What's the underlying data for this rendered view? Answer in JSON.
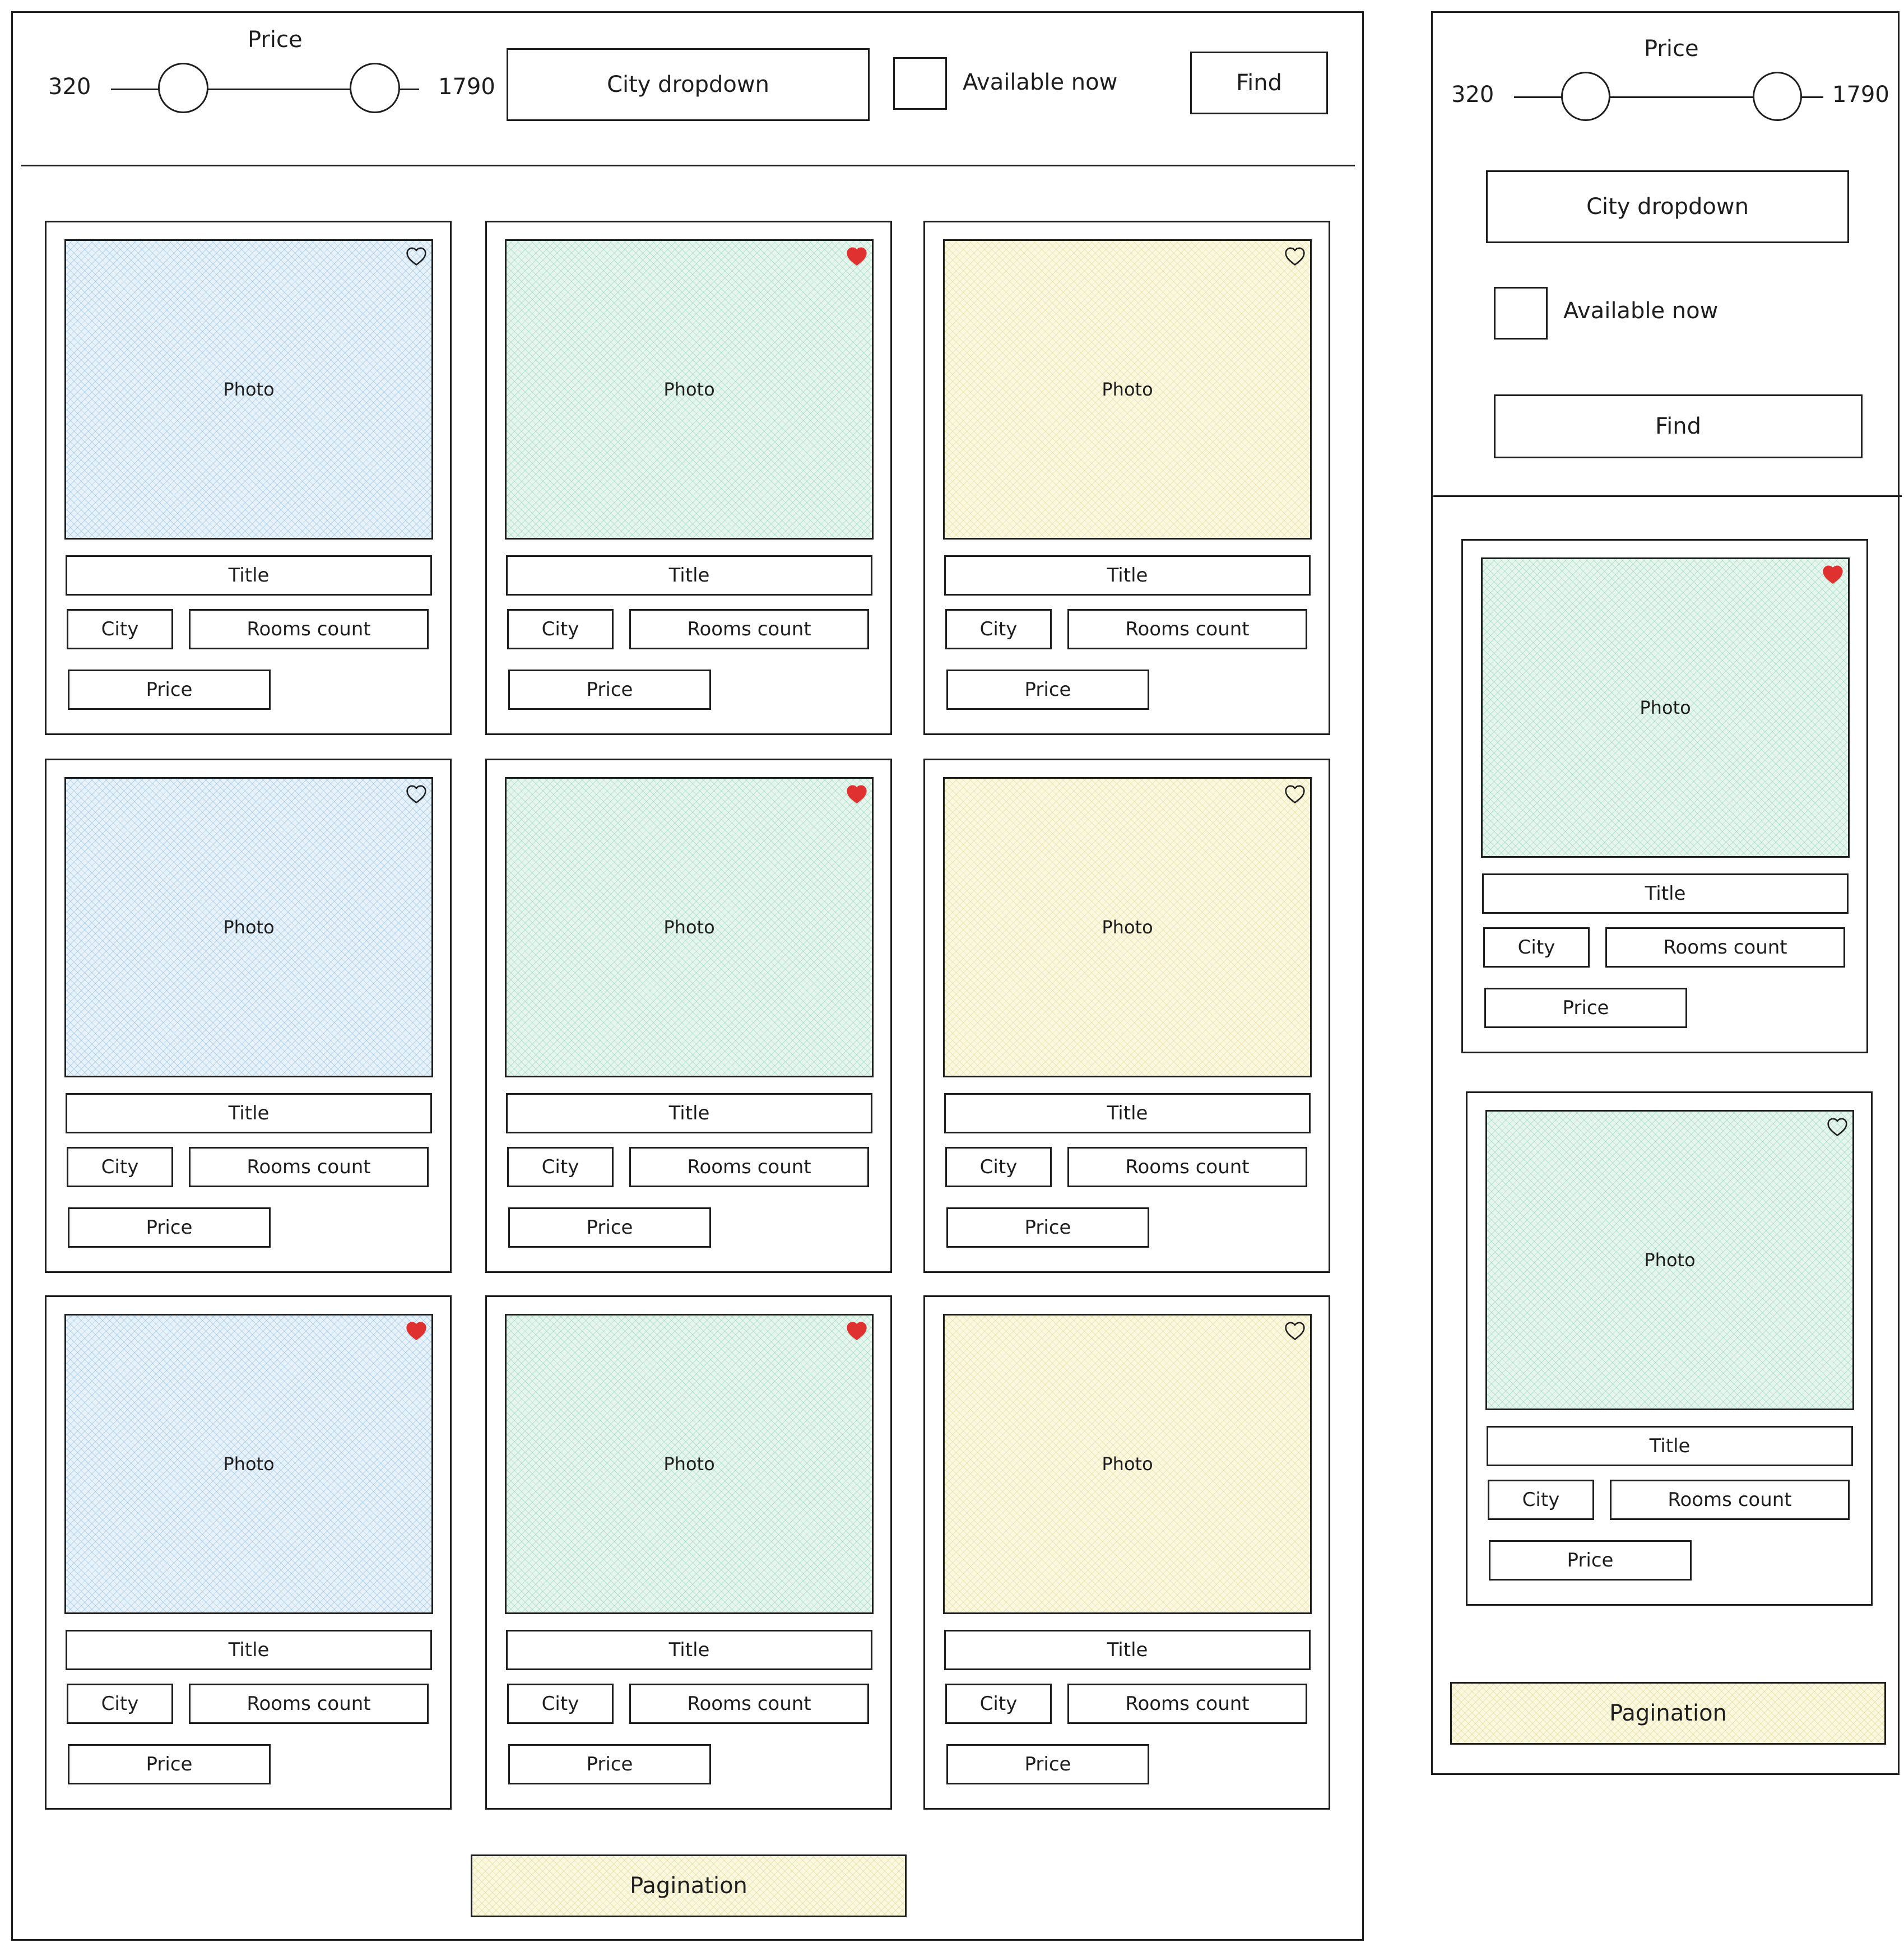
{
  "filters": {
    "price_label": "Price",
    "price_min": "320",
    "price_max": "1790",
    "city_dropdown": "City dropdown",
    "available_now": "Available now",
    "find_button": "Find"
  },
  "card": {
    "photo_label": "Photo",
    "title_label": "Title",
    "city_label": "City",
    "rooms_label": "Rooms count",
    "price_label": "Price"
  },
  "desktop_cards": [
    {
      "photo_color": "blue",
      "favorited": false
    },
    {
      "photo_color": "green",
      "favorited": true
    },
    {
      "photo_color": "yellow",
      "favorited": false
    },
    {
      "photo_color": "blue",
      "favorited": false
    },
    {
      "photo_color": "green",
      "favorited": true
    },
    {
      "photo_color": "yellow",
      "favorited": false
    },
    {
      "photo_color": "blue",
      "favorited": true
    },
    {
      "photo_color": "green",
      "favorited": true
    },
    {
      "photo_color": "yellow",
      "favorited": false
    }
  ],
  "mobile_cards": [
    {
      "photo_color": "green",
      "favorited": true
    },
    {
      "photo_color": "green",
      "favorited": false
    }
  ],
  "pagination_label": "Pagination",
  "colors": {
    "stroke": "#1e1e1e",
    "heart_filled": "#e03131",
    "photo_blue": "#e7f2fb",
    "photo_green": "#e6f6ee",
    "photo_yellow": "#fbf8e0"
  }
}
